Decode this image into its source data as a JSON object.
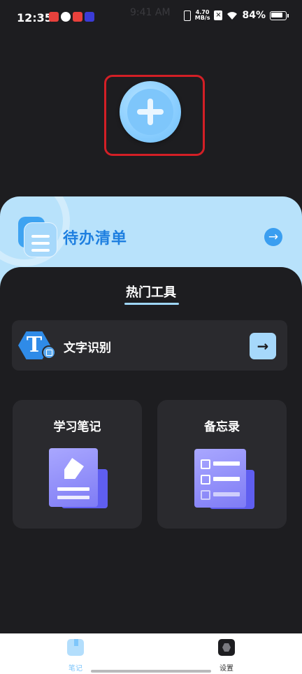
{
  "status_bar": {
    "time": "12:35",
    "ghost_time": "9:41 AM",
    "net_speed_value": "4.70",
    "net_speed_unit": "MB/s",
    "battery": "84%"
  },
  "add_button": {
    "icon": "plus-icon",
    "accent": "#8ccfff"
  },
  "todo": {
    "title": "待办清单",
    "icon": "list-icon",
    "arrow_icon": "arrow-right-icon"
  },
  "tools": {
    "section_title": "热门工具",
    "ocr": {
      "label": "文字识别",
      "icon_letter": "T",
      "arrow": "→"
    },
    "cards": [
      {
        "title": "学习笔记",
        "icon": "note-pen-icon"
      },
      {
        "title": "备忘录",
        "icon": "checklist-icon"
      }
    ]
  },
  "bottom_nav": {
    "items": [
      {
        "label": "笔记",
        "icon": "notebook-icon",
        "active": true
      },
      {
        "label": "设置",
        "icon": "settings-icon",
        "active": false
      }
    ],
    "active_color": "#7ec6fb"
  }
}
